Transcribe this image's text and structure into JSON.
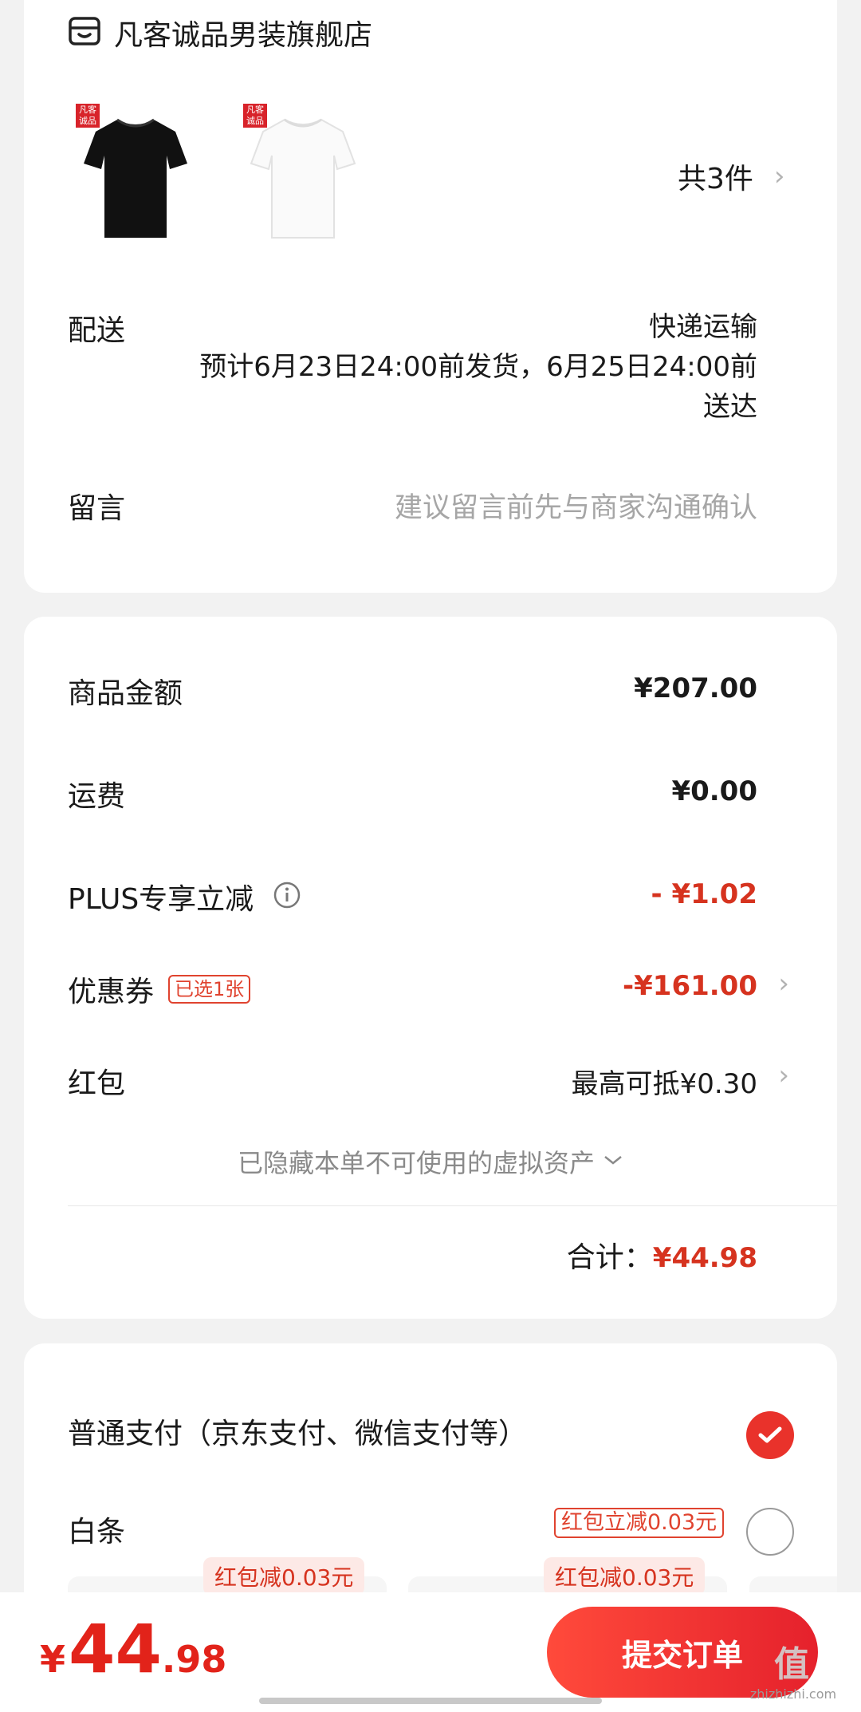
{
  "store": {
    "name": "凡客诚品男装旗舰店",
    "icon": "store-icon"
  },
  "products": {
    "thumbnails": [
      {
        "color": "#111111",
        "badge": "凡客\n诚品"
      },
      {
        "color": "#ffffff",
        "badge": "凡客\n诚品"
      }
    ],
    "count_label": "共3件"
  },
  "delivery": {
    "label": "配送",
    "method": "快递运输",
    "estimate_line1": "预计6月23日24:00前发货，6月25日24:00前",
    "estimate_line2": "送达"
  },
  "message": {
    "label": "留言",
    "placeholder": "建议留言前先与商家沟通确认"
  },
  "price": {
    "goods_label": "商品金额",
    "goods_value": "¥207.00",
    "shipping_label": "运费",
    "shipping_value": "¥0.00",
    "plus_label": "PLUS专享立减",
    "plus_value": "- ¥1.02",
    "coupon_label": "优惠券",
    "coupon_tag": "已选1张",
    "coupon_value": "-¥161.00",
    "redpacket_label": "红包",
    "redpacket_value": "最高可抵¥0.30",
    "hidden_assets": "已隐藏本单不可使用的虚拟资产",
    "total_label": "合计：",
    "total_value": "¥44.98"
  },
  "payment": {
    "normal_label": "普通支付（京东支付、微信支付等）",
    "baitiao_label": "白条",
    "baitiao_tag": "红包立减0.03元",
    "plan_tag_1": "红包减0.03元",
    "plan_tag_2": "红包减0.03元"
  },
  "bottom": {
    "currency": "¥",
    "amount_int": "44",
    "amount_dec": ".98",
    "submit_label": "提交订单"
  },
  "watermark": {
    "logo": "值",
    "site": "zhizhizhi.com"
  },
  "colors": {
    "accent": "#e9322b",
    "price_red": "#d6331f"
  }
}
